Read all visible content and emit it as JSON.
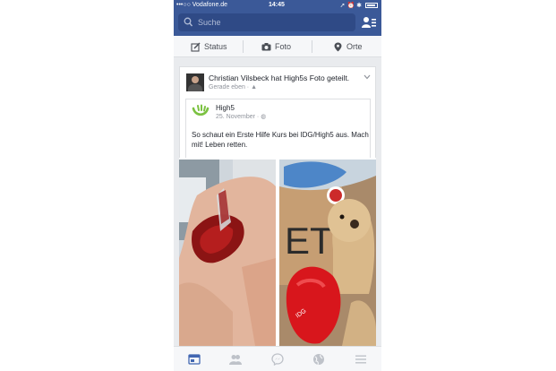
{
  "status_bar": {
    "carrier": "•••○○ Vodafone.de",
    "time": "14:45"
  },
  "search": {
    "placeholder": "Suche"
  },
  "actions": {
    "status": "Status",
    "foto": "Foto",
    "orte": "Orte"
  },
  "post": {
    "title": "Christian Vilsbeck hat High5s Foto geteilt.",
    "meta": "Gerade eben · ",
    "shared": {
      "name": "High5",
      "date": "25. November · ",
      "text": "So schaut ein Erste Hilfe Kurs bei IDG/High5 aus. Mach mit! Leben retten."
    }
  },
  "colors": {
    "facebook_blue": "#3b5998",
    "header_dark": "#2f4a86",
    "high5_green": "#7cc242"
  },
  "tabs": [
    "news-feed-icon",
    "friend-requests-icon",
    "messenger-icon",
    "notifications-globe-icon",
    "more-menu-icon"
  ]
}
